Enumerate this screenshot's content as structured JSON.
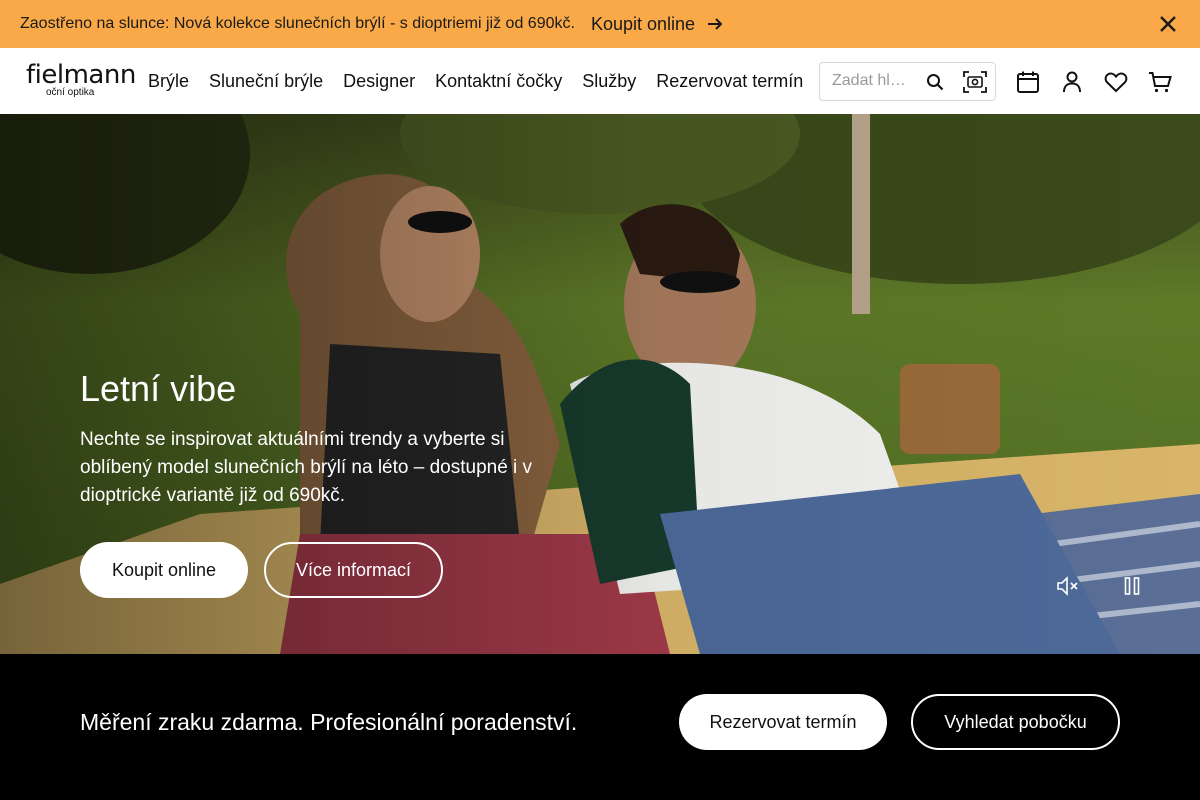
{
  "promo": {
    "text": "Zaostřeno na slunce: Nová kolekce slunečních brýlí - s dioptriemi již od 690kč.",
    "link": "Koupit online"
  },
  "header": {
    "logo_main": "fielmann",
    "logo_sub": "oční optika",
    "nav": [
      "Brýle",
      "Sluneční brýle",
      "Designer",
      "Kontaktní čočky",
      "Služby",
      "Rezervovat termín"
    ],
    "search_placeholder": "Zadat hl…",
    "icons": [
      "calendar-icon",
      "user-icon",
      "heart-icon",
      "cart-icon"
    ]
  },
  "hero": {
    "title": "Letní vibe",
    "text": "Nechte se inspirovat aktuálními trendy a vyberte si oblíbený model slunečních brýlí na léto – dostupné i v dioptrické variantě již od 690kč.",
    "primary_button": "Koupit online",
    "secondary_button": "Více informací"
  },
  "band": {
    "text": "Měření zraku zdarma. Profesionální poradenství.",
    "button_1": "Rezervovat termín",
    "button_2": "Vyhledat pobočku"
  },
  "colors": {
    "promo_bg": "#f9a947",
    "header_bg": "#ffffff",
    "band_bg": "#000000"
  }
}
